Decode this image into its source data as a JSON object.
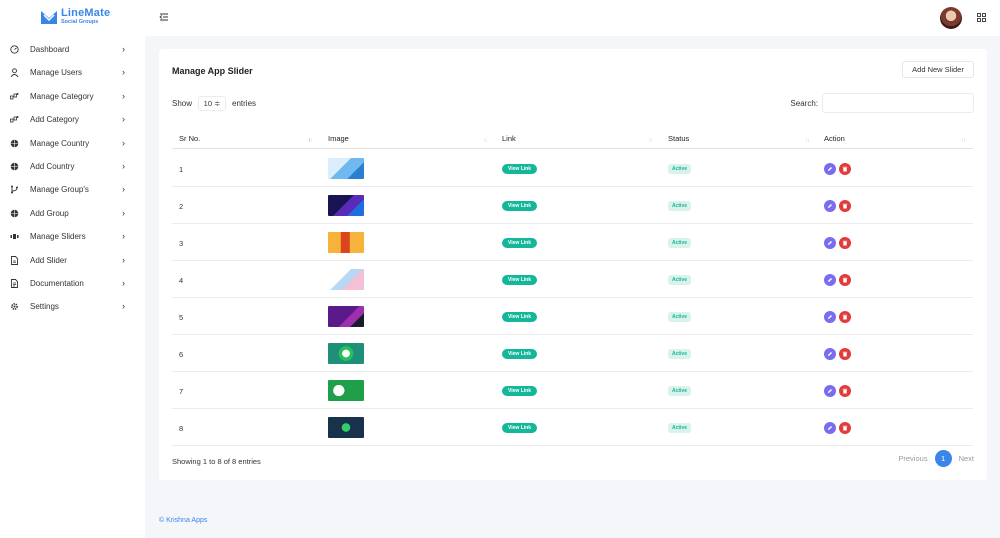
{
  "app": {
    "logo_title": "LineMate",
    "logo_subtitle": "Social Groups",
    "brand_color": "#3a86e8"
  },
  "sidebar": {
    "items": [
      {
        "label": "Dashboard",
        "icon": "dashboard-icon"
      },
      {
        "label": "Manage Users",
        "icon": "user-icon"
      },
      {
        "label": "Manage Category",
        "icon": "category-icon"
      },
      {
        "label": "Add Category",
        "icon": "category-icon"
      },
      {
        "label": "Manage Country",
        "icon": "globe-icon"
      },
      {
        "label": "Add Country",
        "icon": "globe-icon"
      },
      {
        "label": "Manage Group's",
        "icon": "branch-icon"
      },
      {
        "label": "Add Group",
        "icon": "globe-icon"
      },
      {
        "label": "Manage Sliders",
        "icon": "slider-icon"
      },
      {
        "label": "Add Slider",
        "icon": "file-icon"
      },
      {
        "label": "Documentation",
        "icon": "document-icon"
      },
      {
        "label": "Settings",
        "icon": "gear-icon"
      }
    ],
    "chevron": "›"
  },
  "main": {
    "title": "Manage App Slider",
    "add_button": "Add New Slider",
    "show_label": "Show",
    "entries_value": "10 ≑",
    "entries_label": "entries",
    "search_label": "Search:",
    "columns": [
      "Sr No.",
      "Image",
      "Link",
      "Status",
      "Action"
    ],
    "sort_indicator": "↑↓",
    "rows": [
      {
        "no": "1",
        "link": "View Link",
        "status": "Active"
      },
      {
        "no": "2",
        "link": "View Link",
        "status": "Active"
      },
      {
        "no": "3",
        "link": "View Link",
        "status": "Active"
      },
      {
        "no": "4",
        "link": "View Link",
        "status": "Active"
      },
      {
        "no": "5",
        "link": "View Link",
        "status": "Active"
      },
      {
        "no": "6",
        "link": "View Link",
        "status": "Active"
      },
      {
        "no": "7",
        "link": "View Link",
        "status": "Active"
      },
      {
        "no": "8",
        "link": "View Link",
        "status": "Active"
      }
    ],
    "info": "Showing 1 to 8 of 8 entries",
    "pager": {
      "previous": "Previous",
      "page": "1",
      "next": "Next"
    }
  },
  "footer": {
    "text": "© Krishna Apps"
  },
  "colors": {
    "accent": "#3a86e8",
    "link_button": "#15b79a",
    "status_bg": "#d9f3ec",
    "edit": "#7a6cf0",
    "delete": "#e23b3b"
  }
}
